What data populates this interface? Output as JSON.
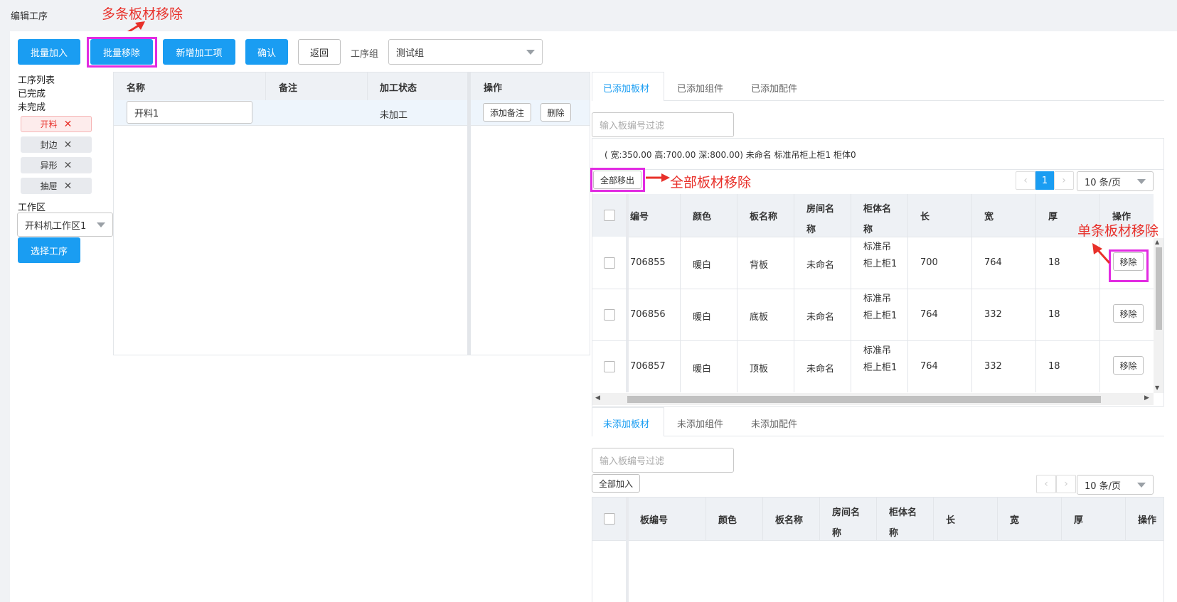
{
  "page_title": "编辑工序",
  "annotations": {
    "multi_remove": "多条板材移除",
    "all_remove": "全部板材移除",
    "single_remove": "单条板材移除"
  },
  "toolbar": {
    "batch_add": "批量加入",
    "batch_remove": "批量移除",
    "add_process_item": "新增加工项",
    "confirm": "确认",
    "back": "返回",
    "group_label": "工序组",
    "group_value": "测试组"
  },
  "sidebar": {
    "list_title": "工序列表",
    "completed": "已完成",
    "uncompleted": "未完成",
    "tags": [
      "开料",
      "封边",
      "异形",
      "抽屉"
    ],
    "workzone_label": "工作区",
    "workzone_value": "开料机工作区1",
    "select_process": "选择工序"
  },
  "process_table": {
    "headers": [
      "名称",
      "备注",
      "加工状态",
      "操作"
    ],
    "row": {
      "name": "开料1",
      "remark": "",
      "status": "未加工",
      "add_remark": "添加备注",
      "delete": "删除"
    }
  },
  "top_panel": {
    "tabs": [
      "已添加板材",
      "已添加组件",
      "已添加配件"
    ],
    "filter_placeholder": "输入板编号过滤",
    "info": "( 宽:350.00 高:700.00 深:800.00) 未命名 标准吊柜上柜1 柜体0",
    "remove_all": "全部移出",
    "page_current": "1",
    "page_size": "10 条/页",
    "headers": [
      "编号",
      "颜色",
      "板名称",
      "房间名称",
      "柜体名称",
      "长",
      "宽",
      "厚",
      "操作"
    ],
    "rows": [
      {
        "code": "706855",
        "color": "暖白",
        "name": "背板",
        "room": "未命名",
        "cabinet": "标准吊柜上柜1",
        "length": "700",
        "width": "764",
        "thick": "18",
        "action": "移除"
      },
      {
        "code": "706856",
        "color": "暖白",
        "name": "底板",
        "room": "未命名",
        "cabinet": "标准吊柜上柜1",
        "length": "764",
        "width": "332",
        "thick": "18",
        "action": "移除"
      },
      {
        "code": "706857",
        "color": "暖白",
        "name": "顶板",
        "room": "未命名",
        "cabinet": "标准吊柜上柜1",
        "length": "764",
        "width": "332",
        "thick": "18",
        "action": "移除"
      }
    ]
  },
  "bottom_panel": {
    "tabs": [
      "未添加板材",
      "未添加组件",
      "未添加配件"
    ],
    "filter_placeholder": "输入板编号过滤",
    "add_all": "全部加入",
    "page_size": "10 条/页",
    "headers": [
      "板编号",
      "颜色",
      "板名称",
      "房间名称",
      "柜体名称",
      "长",
      "宽",
      "厚",
      "操作"
    ]
  },
  "colors": {
    "primary": "#1a9df2",
    "highlight": "#e22be2",
    "annotation": "#e8302a"
  }
}
